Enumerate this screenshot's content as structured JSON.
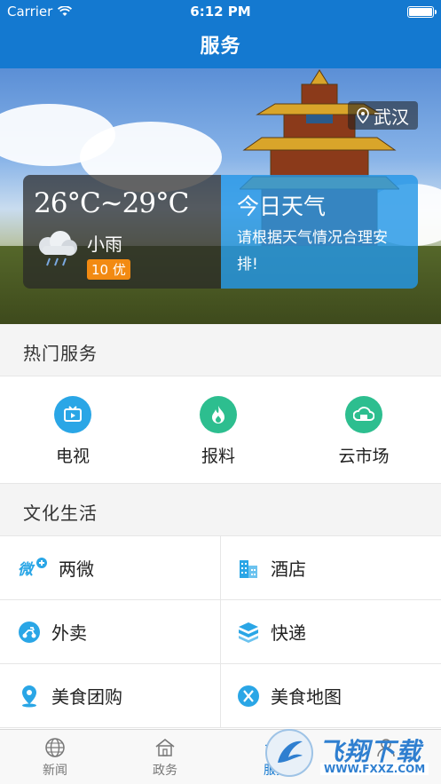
{
  "status_bar": {
    "carrier": "Carrier",
    "time": "6:12 PM"
  },
  "header": {
    "title": "服务"
  },
  "hero": {
    "city": "武汉",
    "temperature": "26°C~29°C",
    "condition": "小雨",
    "aqi": "10 优",
    "card_title": "今日天气",
    "card_text": "请根据天气情况合理安排!"
  },
  "hot_services": {
    "heading": "热门服务",
    "items": [
      {
        "label": "电视",
        "icon": "tv-icon",
        "color": "#2aa6e6"
      },
      {
        "label": "报料",
        "icon": "flame-icon",
        "color": "#2dbe8f"
      },
      {
        "label": "云市场",
        "icon": "cloud-market-icon",
        "color": "#2dbe8f"
      }
    ]
  },
  "culture_life": {
    "heading": "文化生活",
    "items": [
      {
        "label": "两微",
        "icon": "weibo-plus-icon"
      },
      {
        "label": "酒店",
        "icon": "hotel-icon"
      },
      {
        "label": "外卖",
        "icon": "scooter-icon"
      },
      {
        "label": "快递",
        "icon": "package-icon"
      },
      {
        "label": "美食团购",
        "icon": "location-pin-icon"
      },
      {
        "label": "美食地图",
        "icon": "utensils-icon"
      }
    ]
  },
  "tab_bar": {
    "items": [
      {
        "label": "新闻",
        "icon": "globe-icon",
        "active": false
      },
      {
        "label": "政务",
        "icon": "building-icon",
        "active": false
      },
      {
        "label": "服务",
        "icon": "star-icon",
        "active": true
      },
      {
        "label": "我",
        "icon": "user-icon",
        "active": false
      }
    ]
  },
  "watermark": {
    "text": "飞翔下载",
    "url": "WWW.FXXZ.COM"
  },
  "colors": {
    "primary": "#1479d0",
    "accent": "#2aa6e6",
    "aqi": "#f28a12"
  }
}
